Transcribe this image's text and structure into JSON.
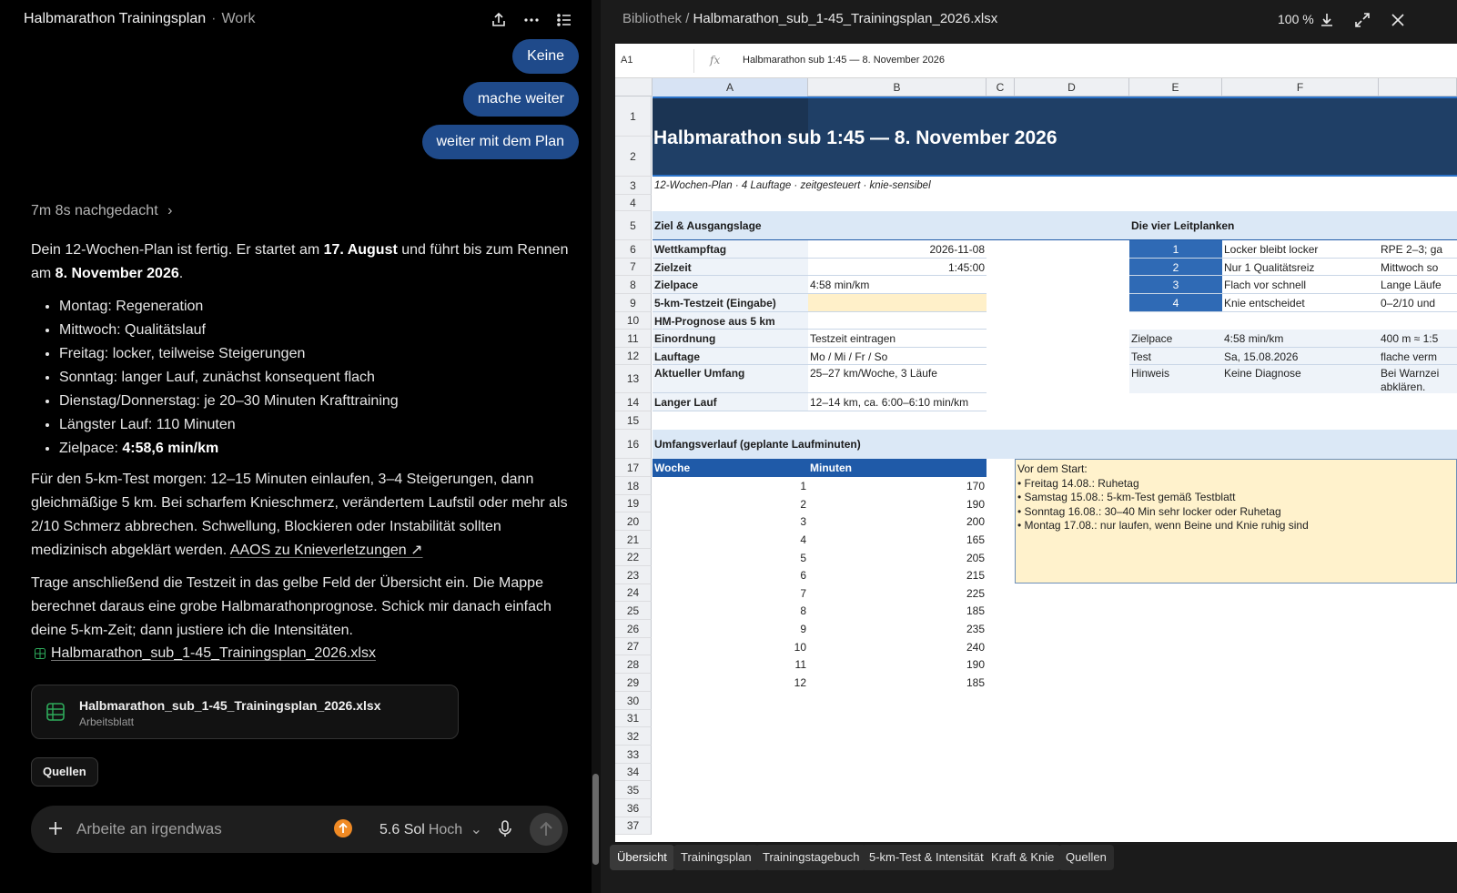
{
  "chat": {
    "title": "Halbmarathon Trainingsplan",
    "workspace": "Work",
    "user_messages": [
      "Keine",
      "mache weiter",
      "weiter mit dem Plan"
    ],
    "thought": "7m 8s nachgedacht",
    "intro_a": "Dein 12-Wochen-Plan ist fertig. Er startet am ",
    "intro_date1": "17. August",
    "intro_b": " und führt bis zum Rennen am ",
    "intro_date2": "8. November 2026",
    "intro_c": ".",
    "bullets": [
      "Montag: Regeneration",
      "Mittwoch: Qualitätslauf",
      "Freitag: locker, teilweise Steigerungen",
      "Sonntag: langer Lauf, zunächst konsequent flach",
      "Dienstag/Donnerstag: je 20–30 Minuten Krafttraining",
      "Längster Lauf: 110 Minuten"
    ],
    "pace_label": "Zielpace: ",
    "pace_value": "4:58,6 min/km",
    "para2": "Für den 5-km-Test morgen: 12–15 Minuten einlaufen, 3–4 Steigerungen, dann gleichmäßige 5 km. Bei scharfem Knieschmerz, verändertem Laufstil oder mehr als 2/10 Schmerz abbrechen. Schwellung, Blockieren oder Instabilität sollten medizinisch abgeklärt werden. ",
    "para2_link": "AAOS zu Knieverletzungen ↗",
    "para3": "Trage anschließend die Testzeit in das gelbe Feld der Übersicht ein. Die Mappe berechnet daraus eine grobe Halbmarathonprognose. Schick mir danach einfach deine 5-km-Zeit; dann justiere ich die Intensitäten.",
    "file_link": "Halbmarathon_sub_1-45_Trainingsplan_2026.xlsx",
    "file_card_name": "Halbmarathon_sub_1-45_Trainingsplan_2026.xlsx",
    "file_card_type": "Arbeitsblatt",
    "sources_label": "Quellen",
    "composer_placeholder": "Arbeite an irgendwas",
    "model_name": "5.6 Sol",
    "model_level": "Hoch"
  },
  "viewer": {
    "path_lib": "Bibliothek /",
    "path_file": "Halbmarathon_sub_1-45_Trainingsplan_2026.xlsx",
    "zoom": "100 %",
    "cell_ref": "A1",
    "fx": "fx",
    "formula_value": "Halbmarathon sub 1:45 — 8. November 2026",
    "columns": [
      "A",
      "B",
      "C",
      "D",
      "E",
      "F"
    ],
    "rows": [
      "1",
      "2",
      "3",
      "4",
      "5",
      "6",
      "7",
      "8",
      "9",
      "10",
      "11",
      "12",
      "13",
      "14",
      "15",
      "16",
      "17",
      "18",
      "19",
      "20",
      "21",
      "22",
      "23",
      "24",
      "25",
      "26",
      "27",
      "28",
      "29",
      "30",
      "31",
      "32",
      "33",
      "34",
      "35",
      "36",
      "37"
    ],
    "sheet": {
      "title": "Halbmarathon sub 1:45 — 8. November 2026",
      "subtitle": "12-Wochen-Plan · 4 Lauftage · zeitgesteuert · knie-sensibel",
      "goal_header": "Ziel & Ausgangslage",
      "goal_rows": [
        {
          "label": "Wettkampftag",
          "value": "2026-11-08"
        },
        {
          "label": "Zielzeit",
          "value": "1:45:00"
        },
        {
          "label": "Zielpace",
          "value": "4:58 min/km"
        },
        {
          "label": "5-km-Testzeit (Eingabe)",
          "value": ""
        },
        {
          "label": "HM-Prognose aus 5 km",
          "value": ""
        },
        {
          "label": "Einordnung",
          "value": "Testzeit eintragen"
        },
        {
          "label": "Lauftage",
          "value": "Mo / Mi / Fr / So"
        },
        {
          "label": "Aktueller Umfang",
          "value": "25–27 km/Woche, 3 Läufe"
        },
        {
          "label": "Langer Lauf",
          "value": "12–14 km, ca. 6:00–6:10 min/km"
        }
      ],
      "rails_header": "Die vier Leitplanken",
      "rails": [
        {
          "num": "1",
          "title": "Locker bleibt locker",
          "desc": "RPE 2–3; ga"
        },
        {
          "num": "2",
          "title": "Nur 1 Qualitätsreiz",
          "desc": "Mittwoch so"
        },
        {
          "num": "3",
          "title": "Flach vor schnell",
          "desc": "Lange Läufe"
        },
        {
          "num": "4",
          "title": "Knie entscheidet",
          "desc": "0–2/10 und"
        }
      ],
      "info_rows": [
        {
          "label": "Zielpace",
          "value": "4:58 min/km",
          "extra": "400 m ≈ 1:5"
        },
        {
          "label": "Test",
          "value": "Sa, 15.08.2026",
          "extra": "flache verm"
        },
        {
          "label": "Hinweis",
          "value": "Keine Diagnose",
          "extra": "Bei Warnzei",
          "extra2": "abklären."
        }
      ],
      "volume_header": "Umfangsverlauf (geplante Laufminuten)",
      "table_headers": [
        "Woche",
        "Minuten"
      ],
      "weeks": [
        {
          "w": "1",
          "m": "170"
        },
        {
          "w": "2",
          "m": "190"
        },
        {
          "w": "3",
          "m": "200"
        },
        {
          "w": "4",
          "m": "165"
        },
        {
          "w": "5",
          "m": "205"
        },
        {
          "w": "6",
          "m": "215"
        },
        {
          "w": "7",
          "m": "225"
        },
        {
          "w": "8",
          "m": "185"
        },
        {
          "w": "9",
          "m": "235"
        },
        {
          "w": "10",
          "m": "240"
        },
        {
          "w": "11",
          "m": "190"
        },
        {
          "w": "12",
          "m": "185"
        }
      ],
      "note_lines": [
        "Vor dem Start:",
        "• Freitag 14.08.: Ruhetag",
        "• Samstag 15.08.: 5-km-Test gemäß Testblatt",
        "• Sonntag 16.08.: 30–40 Min sehr locker oder Ruhetag",
        "• Montag 17.08.: nur laufen, wenn Beine und Knie ruhig sind"
      ]
    },
    "tabs": [
      "Übersicht",
      "Trainingsplan",
      "Trainingstagebuch",
      "5-km-Test & Intensität",
      "Kraft & Knie",
      "Quellen"
    ]
  },
  "colors": {
    "accent_blue": "#1f4a8a",
    "title_band": "#1f3f66",
    "section_fill": "#dbe8f6",
    "input_yellow": "#fff0c9",
    "orange": "#f08a24"
  }
}
